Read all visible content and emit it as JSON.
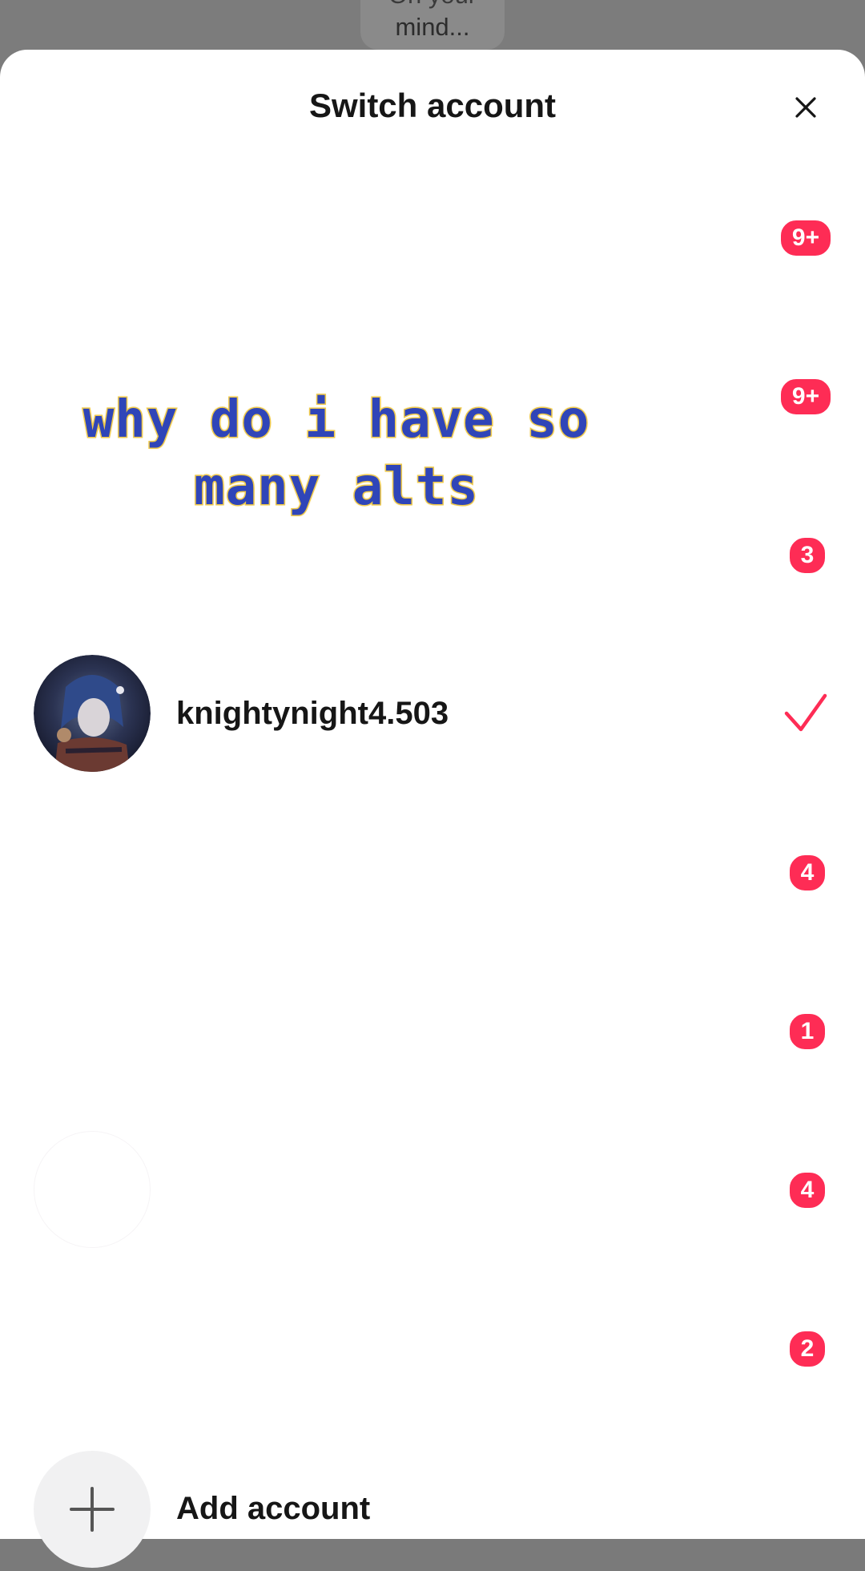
{
  "background": {
    "bubble_text": "mind...",
    "bubble_text_partial": "On your"
  },
  "sheet": {
    "title": "Switch account",
    "close_icon": "close-icon"
  },
  "overlay_caption": "why do i have so many alts",
  "accounts": [
    {
      "username": "",
      "badge": "9+",
      "current": false,
      "visible": false
    },
    {
      "username": "",
      "badge": "9+",
      "current": false,
      "visible": false
    },
    {
      "username": "",
      "badge": "3",
      "current": false,
      "visible": false
    },
    {
      "username": "knightynight4.503",
      "badge": "",
      "current": true,
      "visible": true
    },
    {
      "username": "",
      "badge": "4",
      "current": false,
      "visible": false
    },
    {
      "username": "",
      "badge": "1",
      "current": false,
      "visible": false
    },
    {
      "username": "",
      "badge": "4",
      "current": false,
      "visible": false
    },
    {
      "username": "",
      "badge": "2",
      "current": false,
      "visible": false
    }
  ],
  "add_account": {
    "label": "Add account",
    "icon": "plus-icon"
  },
  "colors": {
    "badge": "#fe2c55",
    "check": "#fe2c55",
    "caption_fill": "#2f45b8",
    "caption_stroke": "#efc94a"
  }
}
